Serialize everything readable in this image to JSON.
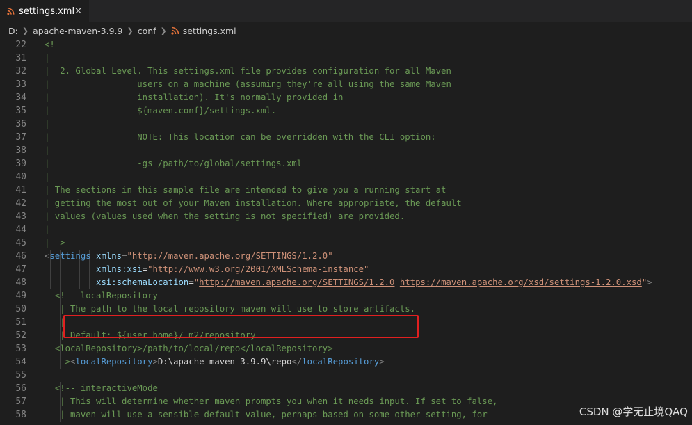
{
  "tab": {
    "title": "settings.xml",
    "close": "✕"
  },
  "breadcrumb": [
    "D:",
    "apache-maven-3.9.9",
    "conf",
    "settings.xml"
  ],
  "watermark": "CSDN @学无止境QAQ",
  "colors": {
    "editor_bg": "#1e1e1e",
    "comment": "#6a9955",
    "tag": "#569cd6",
    "attribute": "#9cdcfe",
    "string": "#ce9178",
    "highlight_border": "#e02020",
    "rss_icon": "#e8733a"
  },
  "lines": [
    {
      "num": "22",
      "tokens": [
        [
          "c",
          "<!--"
        ]
      ]
    },
    {
      "num": "31",
      "tokens": [
        [
          "c",
          "|"
        ]
      ]
    },
    {
      "num": "32",
      "tokens": [
        [
          "c",
          "|  2. Global Level. This settings.xml file provides configuration for all Maven"
        ]
      ]
    },
    {
      "num": "33",
      "tokens": [
        [
          "c",
          "|                 users on a machine (assuming they're all using the same Maven"
        ]
      ]
    },
    {
      "num": "34",
      "tokens": [
        [
          "c",
          "|                 installation). It's normally provided in"
        ]
      ]
    },
    {
      "num": "35",
      "tokens": [
        [
          "c",
          "|                 ${maven.conf}/settings.xml."
        ]
      ]
    },
    {
      "num": "36",
      "tokens": [
        [
          "c",
          "|"
        ]
      ]
    },
    {
      "num": "37",
      "tokens": [
        [
          "c",
          "|                 NOTE: This location can be overridden with the CLI option:"
        ]
      ]
    },
    {
      "num": "38",
      "tokens": [
        [
          "c",
          "|"
        ]
      ]
    },
    {
      "num": "39",
      "tokens": [
        [
          "c",
          "|                 -gs /path/to/global/settings.xml"
        ]
      ]
    },
    {
      "num": "40",
      "tokens": [
        [
          "c",
          "|"
        ]
      ]
    },
    {
      "num": "41",
      "tokens": [
        [
          "c",
          "| The sections in this sample file are intended to give you a running start at"
        ]
      ]
    },
    {
      "num": "42",
      "tokens": [
        [
          "c",
          "| getting the most out of your Maven installation. Where appropriate, the default"
        ]
      ]
    },
    {
      "num": "43",
      "tokens": [
        [
          "c",
          "| values (values used when the setting is not specified) are provided."
        ]
      ]
    },
    {
      "num": "44",
      "tokens": [
        [
          "c",
          "|"
        ]
      ]
    },
    {
      "num": "45",
      "tokens": [
        [
          "c",
          "|-->"
        ]
      ]
    },
    {
      "num": "46",
      "tokens": [
        [
          "p",
          "<"
        ],
        [
          "t",
          "settings"
        ],
        [
          "tx",
          " "
        ],
        [
          "a",
          "xmlns"
        ],
        [
          "e",
          "="
        ],
        [
          "s",
          "\"http://maven.apache.org/SETTINGS/1.2.0\""
        ]
      ]
    },
    {
      "num": "47",
      "tokens": [
        [
          "tx",
          "          "
        ],
        [
          "a",
          "xmlns:xsi"
        ],
        [
          "e",
          "="
        ],
        [
          "s",
          "\"http://www.w3.org/2001/XMLSchema-instance\""
        ]
      ]
    },
    {
      "num": "48",
      "tokens": [
        [
          "tx",
          "          "
        ],
        [
          "a",
          "xsi:schemaLocation"
        ],
        [
          "e",
          "="
        ],
        [
          "s",
          "\""
        ],
        [
          "u",
          "http://maven.apache.org/SETTINGS/1.2.0"
        ],
        [
          "s",
          " "
        ],
        [
          "u",
          "https://maven.apache.org/xsd/settings-1.2.0.xsd"
        ],
        [
          "s",
          "\""
        ],
        [
          "p",
          ">"
        ]
      ]
    },
    {
      "num": "49",
      "tokens": [
        [
          "tx",
          "  "
        ],
        [
          "c",
          "<!-- localRepository"
        ]
      ]
    },
    {
      "num": "50",
      "tokens": [
        [
          "tx",
          "  "
        ],
        [
          "c",
          " | The path to the local repository maven will use to store artifacts."
        ]
      ]
    },
    {
      "num": "51",
      "tokens": [
        [
          "tx",
          "  "
        ],
        [
          "c",
          " |"
        ]
      ]
    },
    {
      "num": "52",
      "tokens": [
        [
          "tx",
          "  "
        ],
        [
          "c",
          " | Default: ${user.home}/.m2/repository"
        ]
      ]
    },
    {
      "num": "53",
      "tokens": [
        [
          "tx",
          "  "
        ],
        [
          "c",
          "<localRepository>/path/to/local/repo</localRepository>"
        ]
      ]
    },
    {
      "num": "54",
      "tokens": [
        [
          "tx",
          "  "
        ],
        [
          "c",
          "-->"
        ],
        [
          "p",
          "<"
        ],
        [
          "t",
          "localRepository"
        ],
        [
          "p",
          ">"
        ],
        [
          "tx",
          "D:\\apache-maven-3.9.9\\repo"
        ],
        [
          "p",
          "</"
        ],
        [
          "t",
          "localRepository"
        ],
        [
          "p",
          ">"
        ]
      ]
    },
    {
      "num": "55",
      "tokens": []
    },
    {
      "num": "56",
      "tokens": [
        [
          "tx",
          "  "
        ],
        [
          "c",
          "<!-- interactiveMode"
        ]
      ]
    },
    {
      "num": "57",
      "tokens": [
        [
          "tx",
          "  "
        ],
        [
          "c",
          " | This will determine whether maven prompts you when it needs input. If set to false,"
        ]
      ]
    },
    {
      "num": "58",
      "tokens": [
        [
          "tx",
          "  "
        ],
        [
          "c",
          " | maven will use a sensible default value, perhaps based on some other setting, for"
        ]
      ]
    }
  ]
}
